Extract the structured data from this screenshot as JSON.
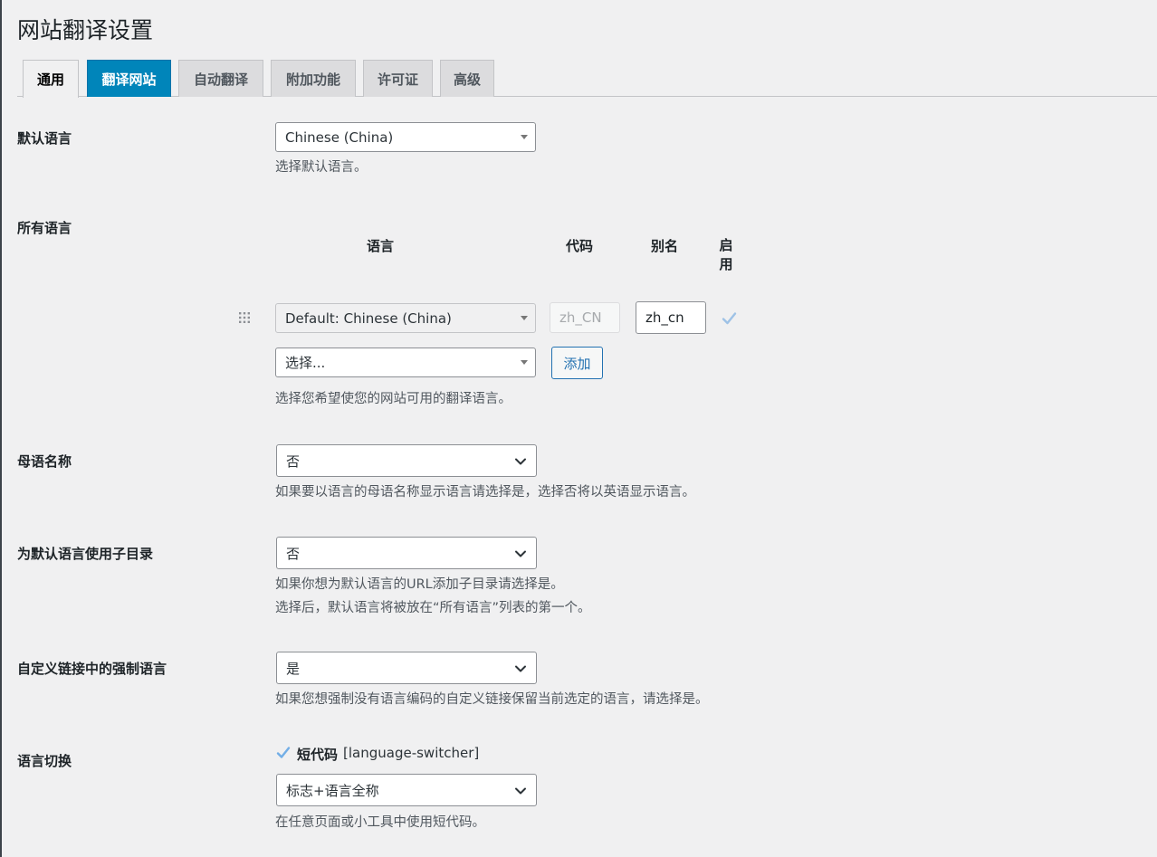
{
  "page": {
    "title": "网站翻译设置"
  },
  "tabs": [
    {
      "label": "通用",
      "state": "active"
    },
    {
      "label": "翻译网站",
      "state": "highlight"
    },
    {
      "label": "自动翻译",
      "state": "normal"
    },
    {
      "label": "附加功能",
      "state": "normal"
    },
    {
      "label": "许可证",
      "state": "normal"
    },
    {
      "label": "高级",
      "state": "normal"
    }
  ],
  "default_language": {
    "label": "默认语言",
    "value": "Chinese (China)",
    "description": "选择默认语言。"
  },
  "all_languages": {
    "label": "所有语言",
    "columns": {
      "language": "语言",
      "code": "代码",
      "alias": "别名",
      "enable": "启用"
    },
    "row": {
      "language": "Default: Chinese (China)",
      "code": "zh_CN",
      "alias": "zh_cn",
      "enabled": true
    },
    "add_select_placeholder": "选择...",
    "add_button": "添加",
    "description": "选择您希望使您的网站可用的翻译语言。"
  },
  "native_names": {
    "label": "母语名称",
    "value": "否",
    "description": "如果要以语言的母语名称显示语言请选择是，选择否将以英语显示语言。"
  },
  "subdirectory": {
    "label": "为默认语言使用子目录",
    "value": "否",
    "description_1": "如果你想为默认语言的URL添加子目录请选择是。",
    "description_2": "选择后，默认语言将被放在“所有语言”列表的第一个。"
  },
  "force_language": {
    "label": "自定义链接中的强制语言",
    "value": "是",
    "description": "如果您想强制没有语言编码的自定义链接保留当前选定的语言，请选择是。"
  },
  "language_switcher": {
    "label": "语言切换",
    "shortcode_checked": true,
    "shortcode_label": "短代码",
    "shortcode_tag": "[language-switcher]",
    "value": "标志+语言全称",
    "description": "在任意页面或小工具中使用短代码。"
  },
  "colors": {
    "accent": "#0085ba",
    "link": "#2271b1",
    "check": "#72aee6"
  }
}
